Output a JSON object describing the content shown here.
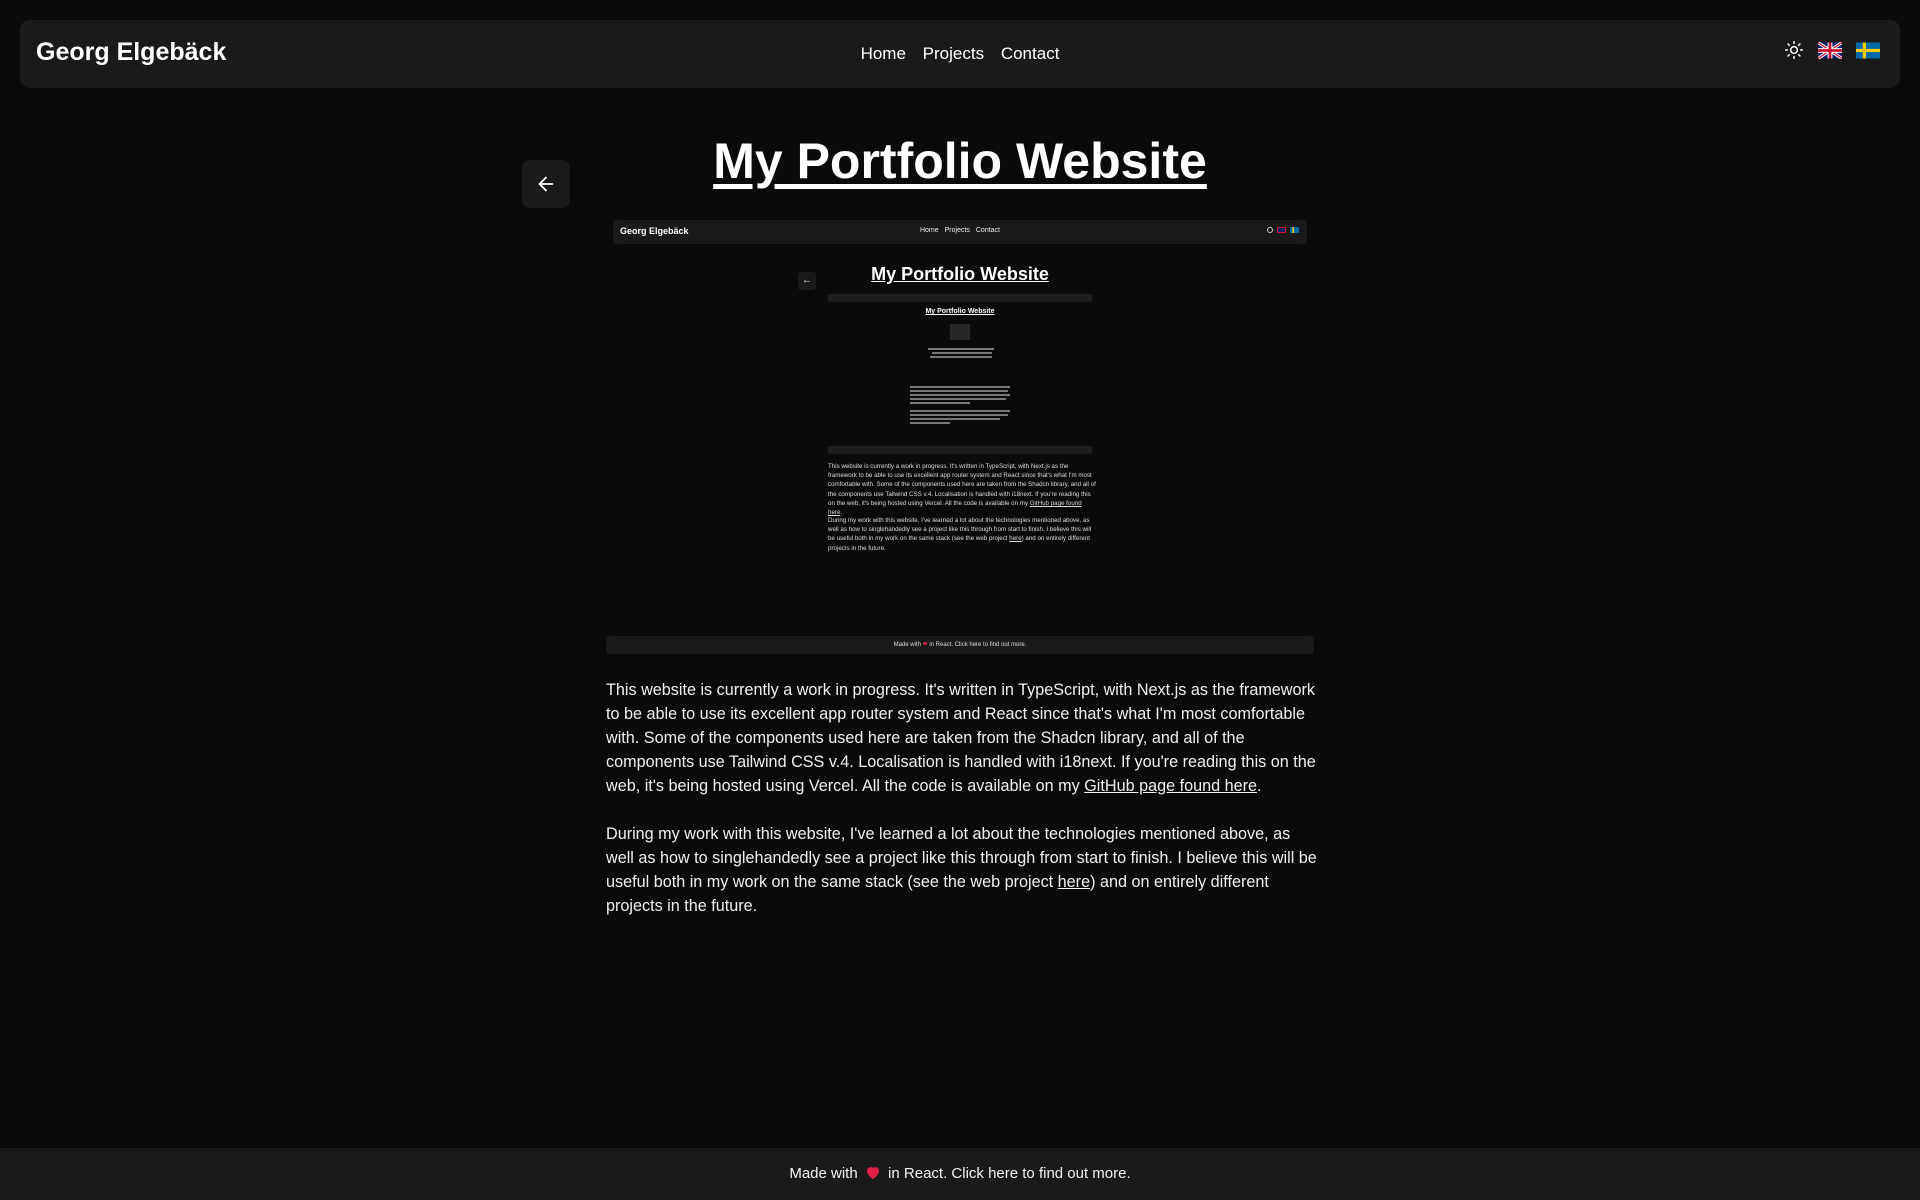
{
  "header": {
    "brand": "Georg Elgebäck",
    "nav": [
      "Home",
      "Projects",
      "Contact"
    ],
    "theme_icon": "sun-icon",
    "languages": [
      {
        "name": "flag-uk-icon"
      },
      {
        "name": "flag-sweden-icon"
      }
    ]
  },
  "page": {
    "back_icon": "arrow-left-icon",
    "title": "My Portfolio Website",
    "paragraph1": {
      "text": "This website is currently a work in progress. It's written in TypeScript, with Next.js as the framework to be able to use its excellent app router system and React since that's what I'm most comfortable with. Some of the components used here are taken from the Shadcn library, and all of the components use Tailwind CSS v.4. Localisation is handled with i18next. If you're reading this on the web, it's being hosted using Vercel. All the code is available on my ",
      "link": "GitHub page found here",
      "end": "."
    },
    "paragraph2": {
      "text": "During my work with this website, I've learned a lot about the technologies mentioned above, as well as how to singlehandedly see a project like this through from start to finish. I believe this will be useful both in my work on the same stack (see the web project ",
      "link": "here",
      "end": ") and on entirely different projects in the future."
    }
  },
  "footer": {
    "before": "Made with",
    "after": "in React. Click here to find out more.",
    "heart_icon": "heart-icon"
  },
  "colors": {
    "background": "#0a0a0a",
    "surface": "#1a1a1a",
    "heart": "#e11d48"
  }
}
